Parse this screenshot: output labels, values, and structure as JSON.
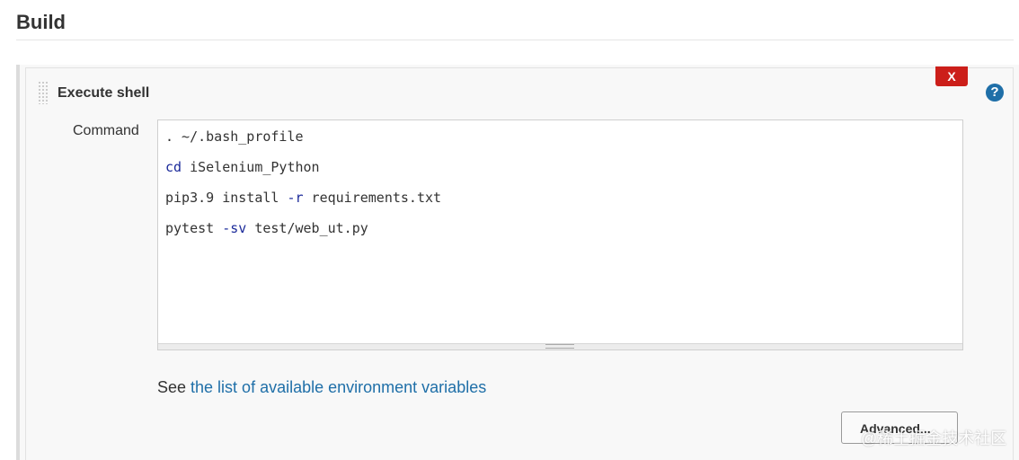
{
  "section": {
    "title": "Build"
  },
  "step": {
    "title": "Execute shell",
    "delete_label": "X",
    "help_label": "?"
  },
  "command": {
    "label": "Command",
    "lines": [
      {
        "plain": ". ~/.bash_profile",
        "parts": [
          {
            "text": ". ~/.bash_profile",
            "kw": false
          }
        ]
      },
      {
        "plain": "cd iSelenium_Python",
        "parts": [
          {
            "text": "cd",
            "kw": true
          },
          {
            "text": " iSelenium_Python",
            "kw": false
          }
        ]
      },
      {
        "plain": "pip3.9 install -r requirements.txt",
        "parts": [
          {
            "text": "pip3.9 install ",
            "kw": false
          },
          {
            "text": "-r",
            "kw": true
          },
          {
            "text": " requirements.txt",
            "kw": false
          }
        ]
      },
      {
        "plain": "pytest -sv test/web_ut.py",
        "parts": [
          {
            "text": "pytest ",
            "kw": false
          },
          {
            "text": "-sv",
            "kw": true
          },
          {
            "text": " test/web_ut.py",
            "kw": false
          }
        ]
      }
    ]
  },
  "env_vars": {
    "prefix": "See ",
    "link_text": "the list of available environment variables"
  },
  "advanced_label": "Advanced...",
  "watermark": "@稀土掘金技术社区",
  "colors": {
    "link": "#1f6fa8",
    "delete": "#cc1f1a",
    "keyword": "#1b2a9a"
  }
}
